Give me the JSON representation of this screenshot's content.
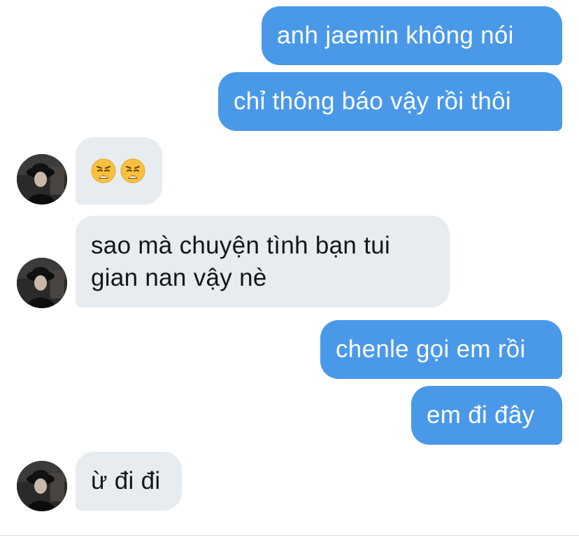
{
  "conversation": {
    "messages": [
      {
        "id": "m1",
        "direction": "outgoing",
        "text": "anh jaemin không nói"
      },
      {
        "id": "m2",
        "direction": "outgoing",
        "text": "chỉ thông báo vậy rồi thôi"
      },
      {
        "id": "m3",
        "direction": "incoming",
        "emojis": [
          "weary-face",
          "weary-face"
        ]
      },
      {
        "id": "m4",
        "direction": "incoming",
        "text": "sao mà chuyện tình bạn tui gian nan vậy nè"
      },
      {
        "id": "m5",
        "direction": "outgoing",
        "text": "chenle gọi em rồi"
      },
      {
        "id": "m6",
        "direction": "outgoing",
        "text": "em đi đây"
      },
      {
        "id": "m7",
        "direction": "incoming",
        "text": "ừ đi đi"
      }
    ]
  },
  "colors": {
    "outgoing_bubble": "#4a99e9",
    "incoming_bubble": "#e6ecf0",
    "outgoing_text": "#ffffff",
    "incoming_text": "#14171a"
  }
}
